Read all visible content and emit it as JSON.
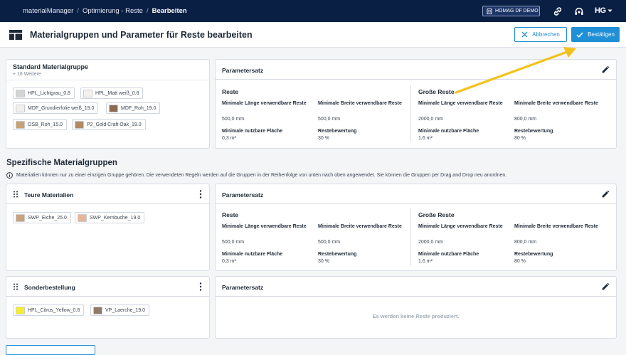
{
  "topbar": {
    "breadcrumb": [
      "materialManager",
      "Optimierung - Reste",
      "Bearbeiten"
    ],
    "tenant": "HOMAG DF DEMO",
    "logo_text": "HG"
  },
  "header": {
    "title": "Materialgruppen und Parameter für Reste bearbeiten",
    "cancel_label": "Abbrechen",
    "confirm_label": "Bestätigen"
  },
  "standard": {
    "title": "Standard Materialgruppe",
    "more": "+ 16 Weitere",
    "chips": [
      {
        "label": "HPL_Lichtgrau_0.8",
        "color": "#d4d4d2"
      },
      {
        "label": "HPL_Matt weiß_0.8",
        "color": "#f2f1ee"
      },
      {
        "label": "MDF_Grundierfolie weiß_19.0",
        "color": "#f1efea"
      },
      {
        "label": "MDF_Roh_19.0",
        "color": "#8b6b52"
      },
      {
        "label": "OSB_Roh_15.0",
        "color": "#c9a174"
      },
      {
        "label": "P2_Gold Craft Oak_19.0",
        "color": "#b28a64"
      }
    ]
  },
  "params": {
    "title": "Parametersatz",
    "reste_title": "Reste",
    "grosse_title": "Große Reste",
    "min_len_label": "Minimale Länge verwendbare Reste",
    "min_wid_label": "Minimale Breite verwendbare Reste",
    "min_area_label": "Minimale nutzbare Fläche",
    "rating_label": "Restebewertung",
    "reste": {
      "min_len": "500,0 mm",
      "min_wid": "500,0 mm",
      "min_area": "0,3 m²",
      "rating": "30 %"
    },
    "grosse": {
      "min_len": "2000,0 mm",
      "min_wid": "800,0 mm",
      "min_area": "1,6 m²",
      "rating": "80 %"
    },
    "empty_text": "Es werden keine Reste produziert."
  },
  "specific": {
    "title": "Spezifische Materialgruppen",
    "info": "Materialien können nur zu einer einzigen Gruppe gehören. Die verwendeten Regeln werden auf die Gruppen in der Reihenfolge von unten nach oben angewendet. Sie können die Gruppen per Drag and Drop neu anordnen.",
    "groups": [
      {
        "title": "Teure Materialien",
        "chips": [
          {
            "label": "SWP_Eiche_25.0",
            "color": "#c9a27b"
          },
          {
            "label": "SWP_Kernbuche_19.0",
            "color": "#e8b596"
          }
        ]
      },
      {
        "title": "Sonderbestellung",
        "chips": [
          {
            "label": "HPL_Citrus_Yellow_0.8",
            "color": "#f5ef2a"
          },
          {
            "label": "VP_Laerche_19.0",
            "color": "#8e7a66"
          }
        ]
      }
    ]
  },
  "colors": {
    "navy": "#0a1f44",
    "accent": "#1f8fd6",
    "arrow": "#f2c21b"
  }
}
